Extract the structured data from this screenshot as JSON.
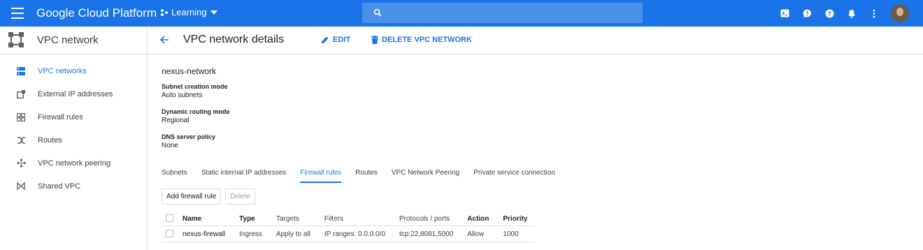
{
  "topbar": {
    "brand": "Google Cloud Platform",
    "project": "Learning",
    "search_placeholder": "",
    "color": "#1a73e8"
  },
  "product": {
    "name": "VPC network"
  },
  "page": {
    "title": "VPC network details",
    "edit_label": "EDIT",
    "delete_label": "DELETE VPC NETWORK"
  },
  "sidebar": {
    "items": [
      {
        "label": "VPC networks",
        "icon": "vpc-networks-icon",
        "active": true
      },
      {
        "label": "External IP addresses",
        "icon": "external-ip-icon",
        "active": false
      },
      {
        "label": "Firewall rules",
        "icon": "firewall-icon",
        "active": false
      },
      {
        "label": "Routes",
        "icon": "routes-icon",
        "active": false
      },
      {
        "label": "VPC network peering",
        "icon": "peering-icon",
        "active": false
      },
      {
        "label": "Shared VPC",
        "icon": "shared-vpc-icon",
        "active": false
      }
    ]
  },
  "network": {
    "name": "nexus-network",
    "subnet_mode_label": "Subnet creation mode",
    "subnet_mode_value": "Auto subnets",
    "routing_label": "Dynamic routing mode",
    "routing_value": "Regional",
    "dns_label": "DNS server policy",
    "dns_value": "None"
  },
  "tabs": [
    {
      "label": "Subnets",
      "active": false
    },
    {
      "label": "Static internal IP addresses",
      "active": false
    },
    {
      "label": "Firewall rules",
      "active": true
    },
    {
      "label": "Routes",
      "active": false
    },
    {
      "label": "VPC Network Peering",
      "active": false
    },
    {
      "label": "Private service connection",
      "active": false
    }
  ],
  "buttons": {
    "add": "Add firewall rule",
    "delete": "Delete"
  },
  "table": {
    "headers": [
      "Name",
      "Type",
      "Targets",
      "Filters",
      "Protocols / ports",
      "Action",
      "Priority"
    ],
    "rows": [
      [
        "nexus-firewall",
        "Ingress",
        "Apply to all",
        "IP ranges: 0.0.0.0/0",
        "tcp:22,8081,5000",
        "Allow",
        "1000"
      ]
    ]
  }
}
